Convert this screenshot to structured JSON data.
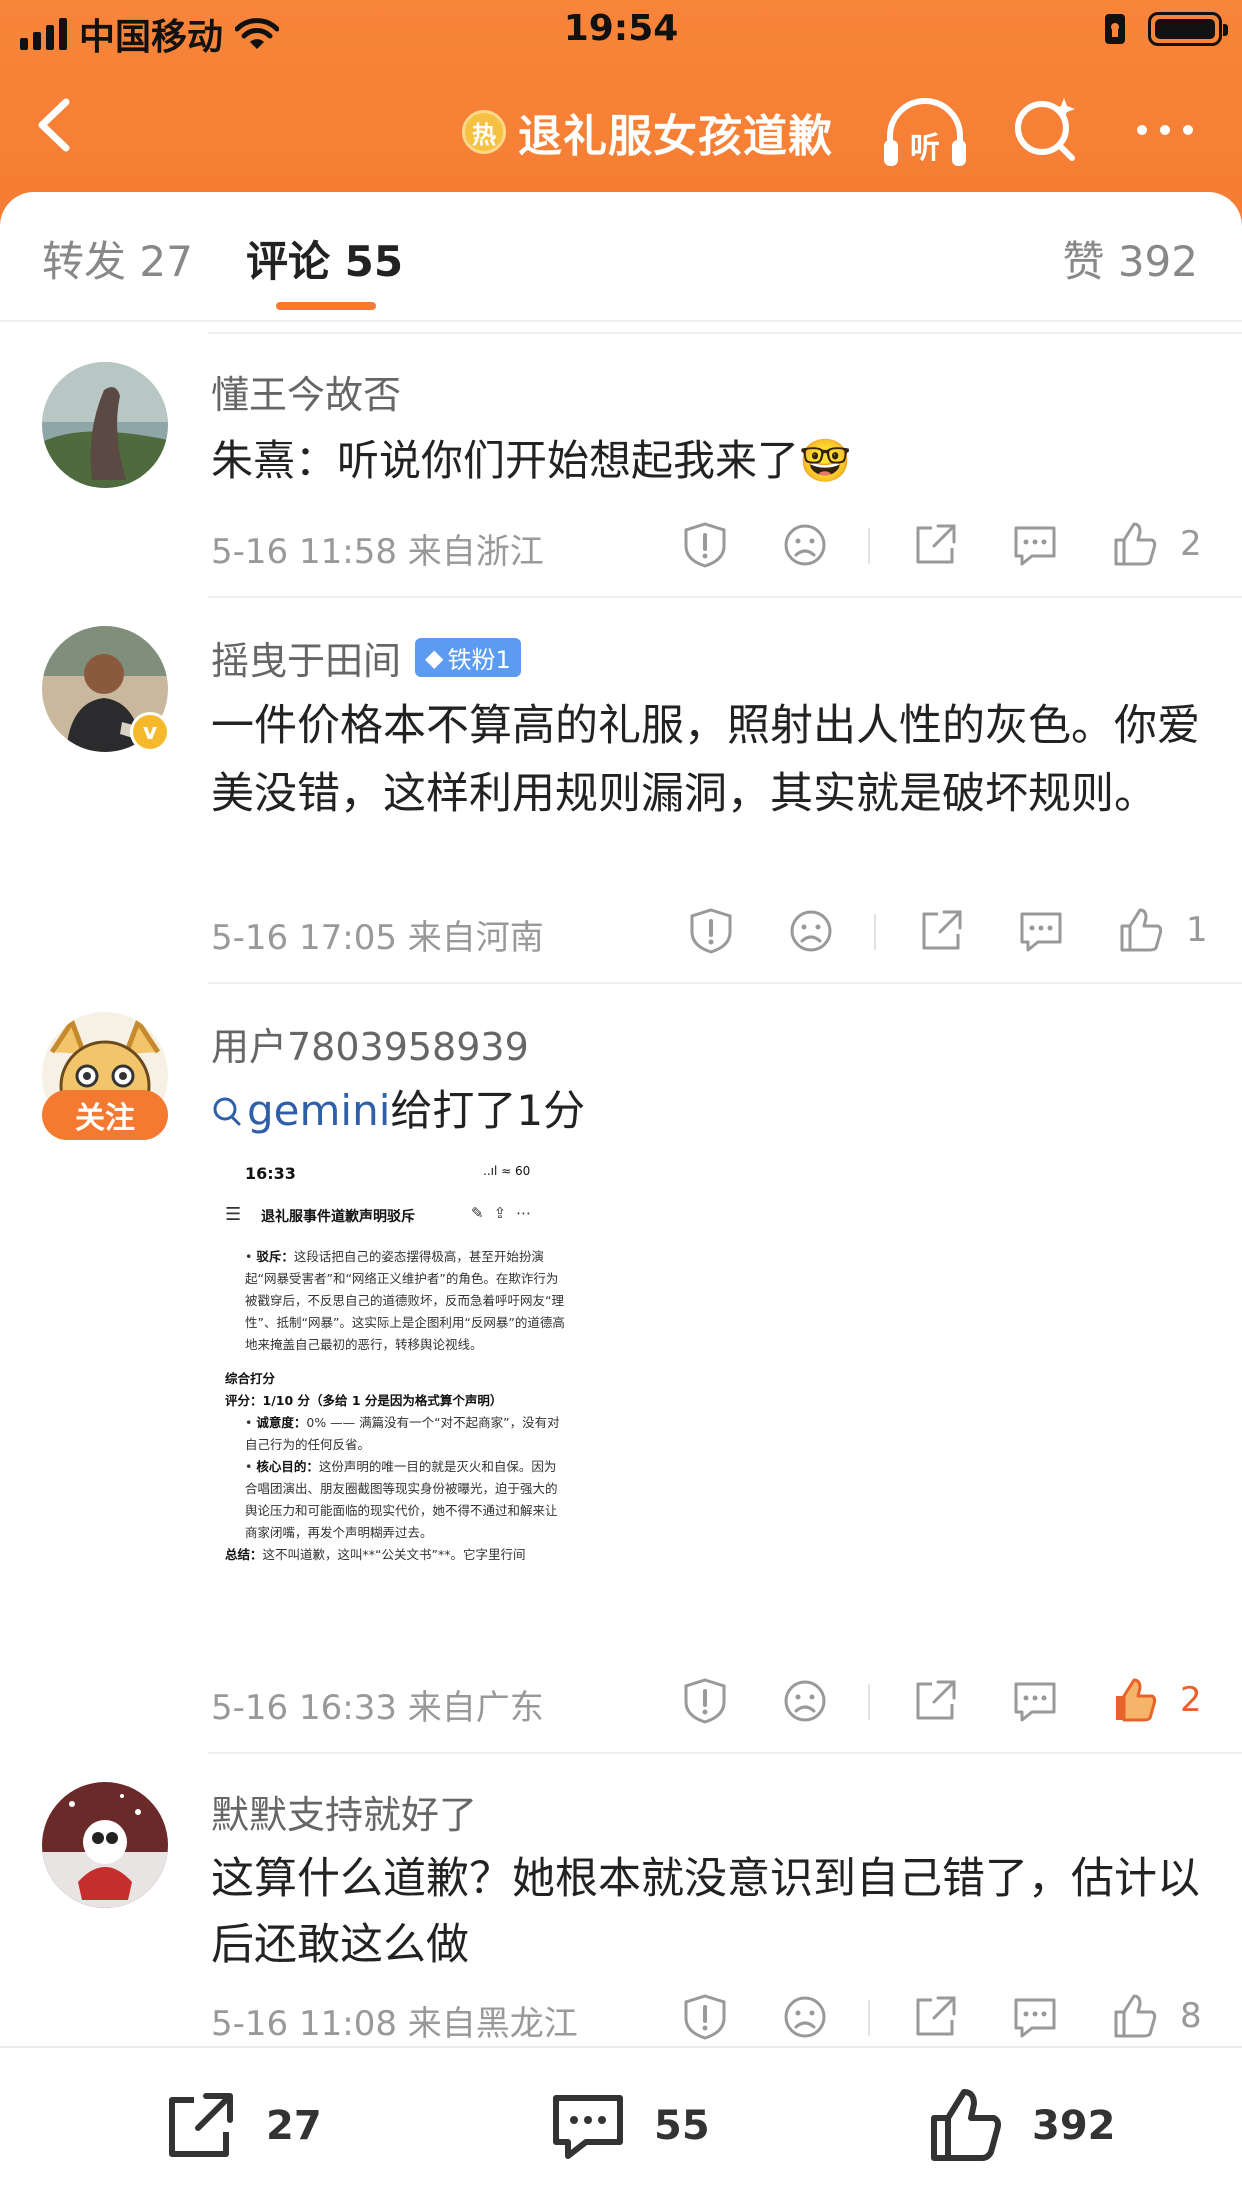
{
  "status_bar": {
    "carrier": "中国移动",
    "time": "19:54"
  },
  "nav": {
    "hot_badge": "热",
    "title": "退礼服女孩道歉",
    "listen_label": "听"
  },
  "tabs": {
    "repost": "转发 27",
    "comment": "评论 55",
    "like": "赞 392"
  },
  "comments": [
    {
      "username": "懂王今故否",
      "text": "朱熹：听说你们开始想起我来了🤓",
      "meta": "5-16 11:58 来自浙江",
      "likes": "2",
      "liked": false
    },
    {
      "username": "摇曳于田间",
      "badge": "铁粉1",
      "text": "一件价格本不算高的礼服，照射出人性的灰色。你爱美没错，这样利用规则漏洞，其实就是破坏规则。",
      "meta": "5-16 17:05 来自河南",
      "likes": "1",
      "liked": false
    },
    {
      "username": "用户7803958939",
      "follow_label": "关注",
      "search_tag": "gemini",
      "text": "给打了1分",
      "meta": "5-16 16:33 来自广东",
      "likes": "2",
      "liked": true
    },
    {
      "username": "默默支持就好了",
      "text": "这算什么道歉？她根本就没意识到自己错了，估计以后还敢这么做",
      "meta": "5-16 11:08 来自黑龙江",
      "likes": "8",
      "liked": false
    }
  ],
  "embedded": {
    "time": "16:33",
    "status": "..ıl ≈ 60",
    "title": "退礼服事件道歉声明驳斥",
    "p1_label": "驳斥：",
    "p1_text": "这段话把自己的姿态摆得极高，甚至开始扮演起“网暴受害者”和“网络正义维护者”的角色。在欺诈行为被戳穿后，不反思自己的道德败坏，反而急着呼吁网友“理性”、抵制“网暴”。这实际上是企图利用“反网暴”的道德高地来掩盖自己最初的恶行，转移舆论视线。",
    "section": "综合打分",
    "score": "评分：1/10 分（多给 1 分是因为格式算个声明）",
    "b1_label": "诚意度：",
    "b1_text": "0% —— 满篇没有一个“对不起商家”，没有对自己行为的任何反省。",
    "b2_label": "核心目的：",
    "b2_text": "这份声明的唯一目的就是灭火和自保。因为合唱团演出、朋友圈截图等现实身份被曝光，迫于强大的舆论压力和可能面临的现实代价，她不得不通过和解来让商家闭嘴，再发个声明糊弄过去。",
    "summary_label": "总结：",
    "summary_text": "这不叫道歉，这叫**“公关文书”**。它字里行间"
  },
  "bottom_bar": {
    "repost": "27",
    "comment": "55",
    "like": "392"
  },
  "colors": {
    "accent": "#f47a31",
    "link": "#2e5fa8",
    "fan_badge": "#5b9bf2",
    "liked": "#e8632a"
  }
}
